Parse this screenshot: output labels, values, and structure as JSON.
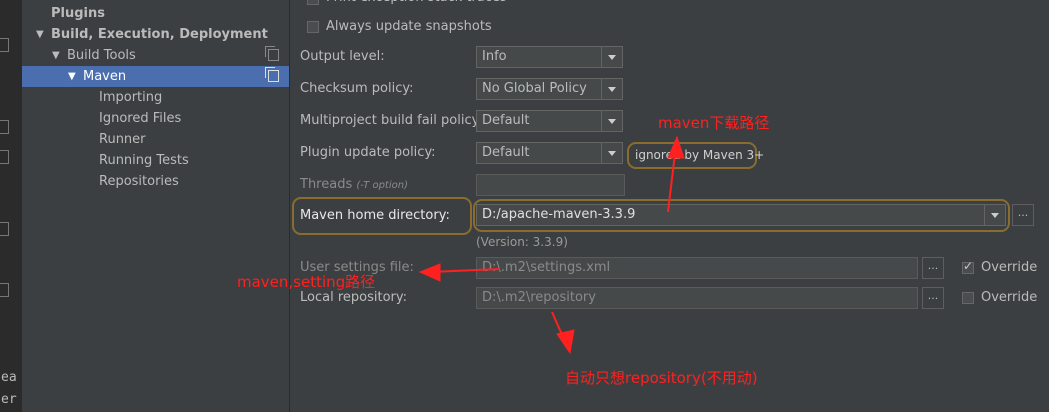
{
  "edge": {
    "text1": "ea",
    "text2": "er"
  },
  "sidebar": {
    "items": [
      {
        "label": "Plugins"
      },
      {
        "label": "Build, Execution, Deployment"
      },
      {
        "label": "Build Tools"
      },
      {
        "label": "Maven"
      },
      {
        "label": "Importing"
      },
      {
        "label": "Ignored Files"
      },
      {
        "label": "Runner"
      },
      {
        "label": "Running Tests"
      },
      {
        "label": "Repositories"
      }
    ]
  },
  "main": {
    "print_exception": "Print exception stack traces",
    "always_update": "Always update snapshots",
    "output_level": {
      "label": "Output level:",
      "value": "Info"
    },
    "checksum_policy": {
      "label": "Checksum policy:",
      "value": "No Global Policy"
    },
    "multiproject_policy": {
      "label": "Multiproject build fail policy:",
      "value": "Default"
    },
    "plugin_update_policy": {
      "label": "Plugin update policy:",
      "value": "Default",
      "note": "ignored by Maven 3+"
    },
    "threads": {
      "label": "Threads",
      "hint": "(-T option)",
      "value": ""
    },
    "maven_home": {
      "label": "Maven home directory:",
      "value": "D:/apache-maven-3.3.9",
      "version": "(Version: 3.3.9)"
    },
    "user_settings": {
      "label": "User settings file:",
      "value": "D:\\.m2\\settings.xml",
      "override": "Override"
    },
    "local_repo": {
      "label": "Local repository:",
      "value": "D:\\.m2\\repository",
      "override": "Override"
    },
    "browse": "..."
  },
  "annotations": {
    "maven_download": "maven下载路径",
    "maven_setting": "maven,setting路径",
    "repository_note": "自动只想repository(不用动)"
  },
  "colors": {
    "background": "#3c3f41",
    "selection": "#4b6eaf",
    "annotation": "#ff2020",
    "highlight_border": "#8a6d2e"
  }
}
